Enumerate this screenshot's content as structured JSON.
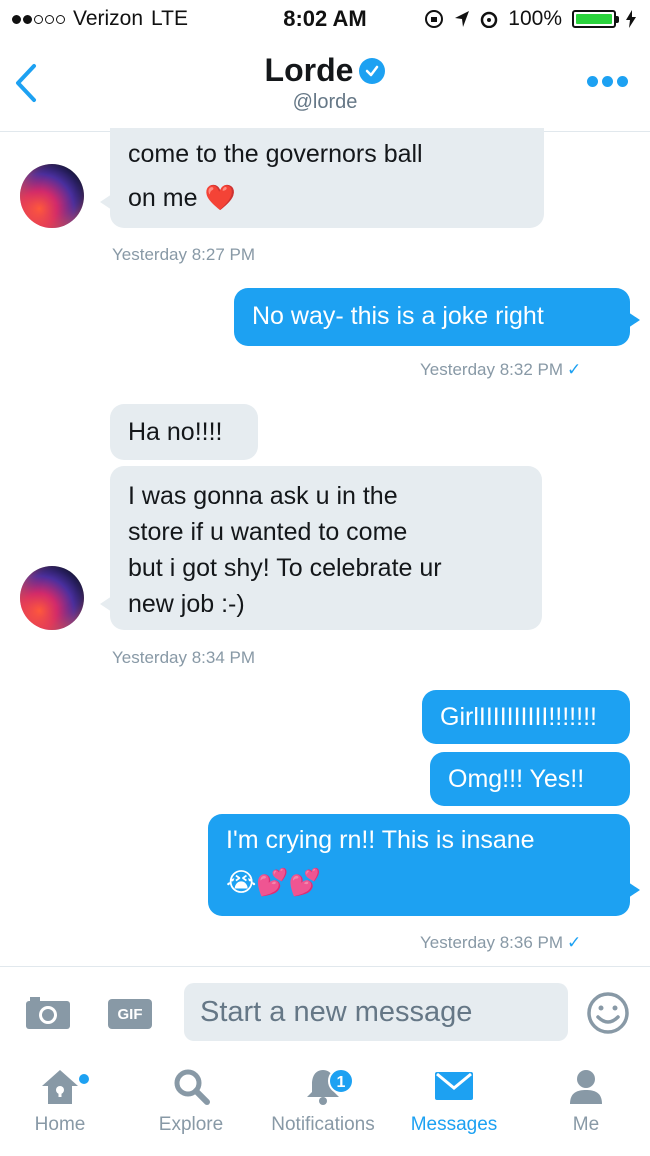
{
  "status": {
    "carrier": "Verizon",
    "network": "LTE",
    "time": "8:02 AM",
    "battery": "100%",
    "battery_level": 1.0
  },
  "header": {
    "name": "Lorde",
    "handle": "@lorde"
  },
  "messages": {
    "m1": {
      "text": "come to the governors ball",
      "text2": "on me",
      "emoji": "❤️"
    },
    "t1": "Yesterday 8:27 PM",
    "m2": {
      "text": "No way- this is a joke right"
    },
    "t2": "Yesterday 8:32 PM",
    "m3": {
      "text": "Ha no!!!!"
    },
    "m4": {
      "line1": "I was gonna ask u in the",
      "line2": "store if u wanted to come",
      "line3": "but i got shy! To celebrate ur",
      "line4": "new job :-)"
    },
    "t3": "Yesterday 8:34 PM",
    "m5": {
      "text": "GirlIIIIIIIIII!!!!!!!"
    },
    "m6": {
      "text": "Omg!!! Yes!!"
    },
    "m7": {
      "text": "I'm crying rn!! This is insane",
      "emoji": "😭💕💕"
    },
    "t4": "Yesterday 8:36 PM"
  },
  "compose": {
    "gif_label": "GIF",
    "placeholder": "Start a new message"
  },
  "tabs": {
    "home": "Home",
    "explore": "Explore",
    "notifications": "Notifications",
    "notifications_count": "1",
    "messages": "Messages",
    "me": "Me"
  },
  "colors": {
    "accent": "#1da1f2",
    "incoming_bubble": "#e6ecf0",
    "muted": "#8899a6"
  }
}
